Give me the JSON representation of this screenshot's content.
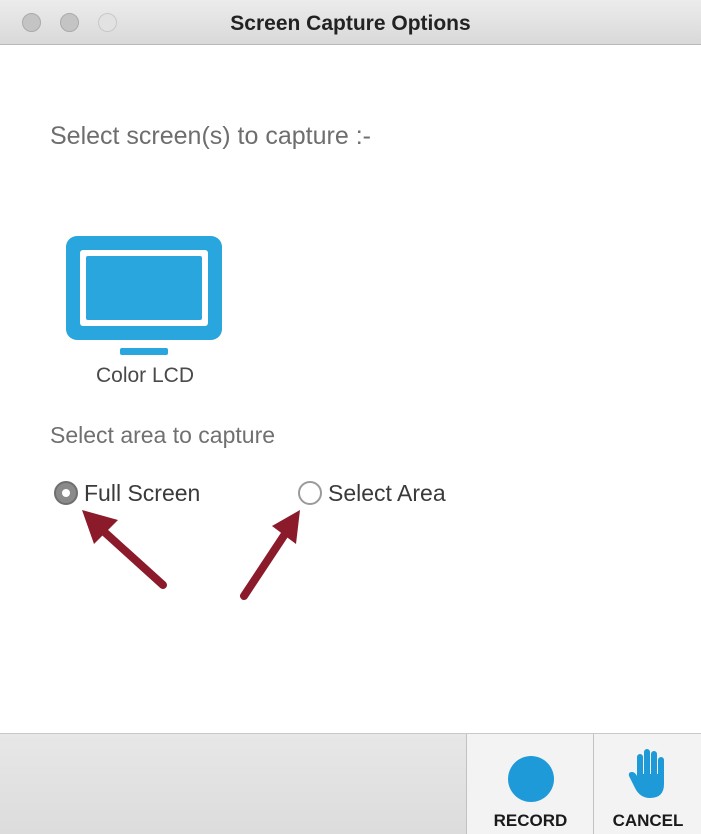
{
  "window": {
    "title": "Screen Capture Options",
    "controls": [
      "close-button",
      "minimize-button",
      "zoom-button"
    ]
  },
  "capture": {
    "prompt": "Select screen(s) to capture :-",
    "displays": [
      {
        "label": "Color LCD",
        "icon": "monitor-icon",
        "color": "#29a6dd"
      }
    ],
    "area_heading": "Select area to capture",
    "area_options": [
      {
        "label": "Full Screen",
        "checked": true
      },
      {
        "label": "Select Area",
        "checked": false
      }
    ]
  },
  "annotations": {
    "arrow_color": "#8b1a2b",
    "arrow_count": 2
  },
  "footer": {
    "record_label": "RECORD",
    "record_icon": "record-dot-icon",
    "cancel_label": "CANCEL",
    "cancel_icon": "hand-stop-icon",
    "accent": "#1f9ad8"
  }
}
